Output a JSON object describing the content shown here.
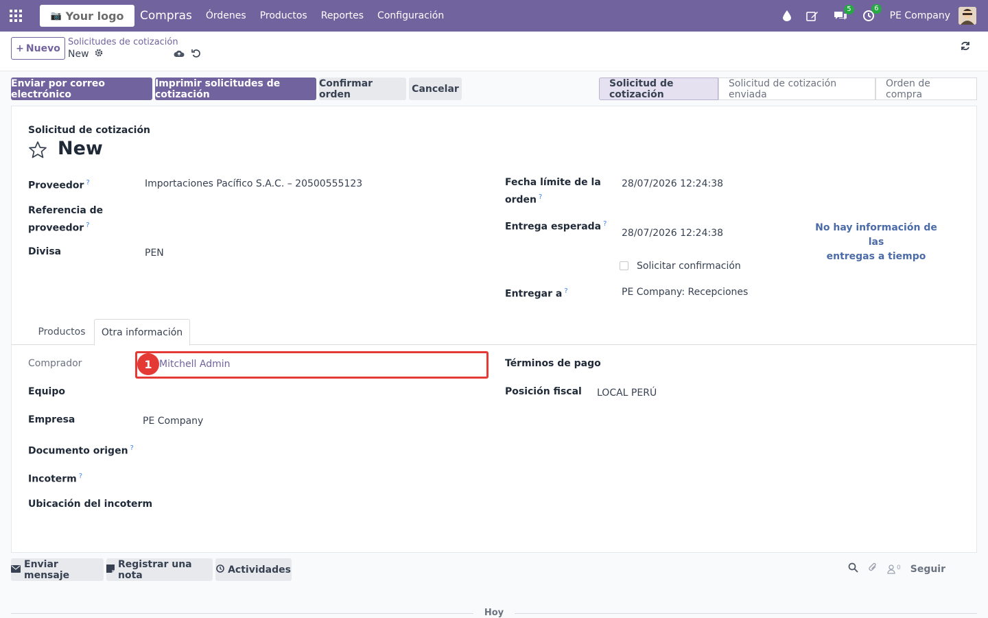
{
  "navbar": {
    "logo_text": "Your logo",
    "app_name": "Compras",
    "menu": [
      "Órdenes",
      "Productos",
      "Reportes",
      "Configuración"
    ],
    "messages_count": "5",
    "activities_count": "6",
    "company": "PE Company",
    "bg_color": "#71639e"
  },
  "control_panel": {
    "new_button": "Nuevo",
    "breadcrumb": "Solicitudes de cotización",
    "record_name": "New"
  },
  "actions": {
    "send_email": "Enviar por correo electrónico",
    "print": "Imprimir solicitudes de cotización",
    "confirm": "Confirmar orden",
    "cancel": "Cancelar"
  },
  "statusbar": [
    "Solicitud de cotización",
    "Solicitud de cotización enviada",
    "Orden de compra"
  ],
  "form": {
    "doc_type": "Solicitud de cotización",
    "title": "New",
    "proveedor_label": "Proveedor",
    "proveedor_value": "Importaciones Pacífico S.A.C. – 20500555123",
    "ref_label_1": "Referencia de",
    "ref_label_2": "proveedor",
    "divisa_label": "Divisa",
    "divisa_value": "PEN",
    "fecha_label_1": "Fecha límite de la",
    "fecha_label_2": "orden",
    "fecha_value": "28/07/2026 12:24:38",
    "entrega_label": "Entrega esperada",
    "entrega_value": "28/07/2026 12:24:38",
    "ontime_1": "No hay información de las",
    "ontime_2": "entregas a tiempo",
    "confirm_label": "Solicitar confirmación",
    "entregar_label": "Entregar a",
    "entregar_value": "PE Company: Recepciones"
  },
  "tabs": [
    "Productos",
    "Otra información"
  ],
  "other_info": {
    "comprador_label": "Comprador",
    "comprador_value": "Mitchell Admin",
    "equipo_label": "Equipo",
    "empresa_label": "Empresa",
    "empresa_value": "PE Company",
    "doc_origen_label": "Documento origen",
    "incoterm_label": "Incoterm",
    "ubicacion_label": "Ubicación del incoterm",
    "terminos_label": "Términos de pago",
    "posicion_label": "Posición fiscal",
    "posicion_value": "LOCAL PERÚ",
    "marker": "1"
  },
  "chatter": {
    "send_message": "Enviar mensaje",
    "log_note": "Registrar una nota",
    "activities": "Actividades",
    "followers_count": "0",
    "follow": "Seguir",
    "today": "Hoy"
  }
}
